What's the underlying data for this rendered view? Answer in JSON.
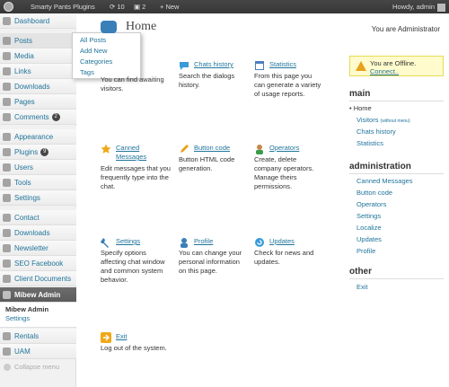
{
  "adminbar": {
    "site_name": "Smarty Pants Plugins",
    "updates_count": "10",
    "comments_count": "2",
    "new_label": "+ New",
    "howdy": "Howdy, admin"
  },
  "sidebar": {
    "items": [
      {
        "label": "Dashboard"
      },
      {
        "label": "Posts"
      },
      {
        "label": "Media"
      },
      {
        "label": "Links"
      },
      {
        "label": "Downloads"
      },
      {
        "label": "Pages"
      },
      {
        "label": "Comments",
        "badge": "2"
      },
      {
        "label": "Appearance"
      },
      {
        "label": "Plugins",
        "badge": "9"
      },
      {
        "label": "Users"
      },
      {
        "label": "Tools"
      },
      {
        "label": "Settings"
      },
      {
        "label": "Contact"
      },
      {
        "label": "Downloads"
      },
      {
        "label": "Newsletter"
      },
      {
        "label": "SEO Facebook"
      },
      {
        "label": "Client Documents"
      },
      {
        "label": "Mibew Admin"
      },
      {
        "label": "Rentals"
      },
      {
        "label": "UAM"
      }
    ],
    "submenu": {
      "head": "Mibew Admin",
      "item": "Settings"
    },
    "collapse": "Collapse menu"
  },
  "flyout": [
    "All Posts",
    "Add New",
    "Categories",
    "Tags"
  ],
  "main": {
    "title": "Home",
    "you_are": "You are Administrator",
    "tiles": [
      {
        "link": "",
        "desc": "You can find awaiting visitors."
      },
      {
        "link": "Chats history",
        "desc": "Search the dialogs history."
      },
      {
        "link": "Statistics",
        "desc": "From this page you can generate a variety of usage reports."
      },
      {
        "link": "Canned Messages",
        "desc": "Edit messages that you frequently type into the chat."
      },
      {
        "link": "Button code",
        "desc": "Button HTML code generation."
      },
      {
        "link": "Operators",
        "desc": "Create, delete company operators. Manage theirs permissions."
      },
      {
        "link": "Settings",
        "desc": "Specify options affecting chat window and common system behavior."
      },
      {
        "link": "Profile",
        "desc": "You can change your personal information on this page."
      },
      {
        "link": "Updates",
        "desc": "Check for news and updates."
      },
      {
        "link": "Exit",
        "desc": "Log out of the system."
      }
    ]
  },
  "panel": {
    "offline_text": "You are Offline.",
    "offline_link": "Connect..",
    "main_title": "main",
    "main_links": [
      "Home",
      "Visitors",
      "Chats history",
      "Statistics"
    ],
    "visitors_note": "(without menu)",
    "admin_title": "administration",
    "admin_links": [
      "Canned Messages",
      "Button code",
      "Operators",
      "Settings",
      "Localize",
      "Updates",
      "Profile"
    ],
    "other_title": "other",
    "other_links": [
      "Exit"
    ]
  }
}
